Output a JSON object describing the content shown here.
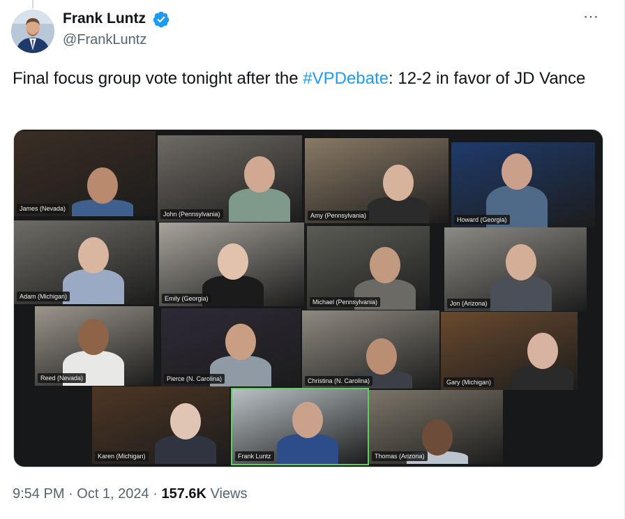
{
  "author": {
    "name": "Frank Luntz",
    "handle": "@FrankLuntz",
    "verified": true
  },
  "more_icon": "⋯",
  "tweet": {
    "text_before": "Final focus group vote tonight after the ",
    "hashtag": "#VPDebate",
    "text_after": ":  12-2 in favor of JD Vance"
  },
  "media": {
    "participants": [
      {
        "label": "James (Nevada)"
      },
      {
        "label": "John (Pennsylvania)"
      },
      {
        "label": "Amy (Pennsylvania)"
      },
      {
        "label": "Howard (Georgia)"
      },
      {
        "label": "Adam (Michigan)"
      },
      {
        "label": "Emily (Georgia)"
      },
      {
        "label": "Michael (Pennsylvania)"
      },
      {
        "label": "Jon (Arizona)"
      },
      {
        "label": "Reed (Nevada)"
      },
      {
        "label": "Pierce (N. Carolina)"
      },
      {
        "label": "Christina (N. Carolina)"
      },
      {
        "label": "Gary (Michigan)"
      },
      {
        "label": "Karen (Michigan)"
      },
      {
        "label": "Frank Luntz"
      },
      {
        "label": "Thomas (Arizona)"
      }
    ]
  },
  "meta": {
    "time": "9:54 PM",
    "separator": " · ",
    "date": "Oct 1, 2024",
    "views_count": "157.6K",
    "views_label": " Views"
  },
  "colors": {
    "hashtag": "#1d9bf0",
    "secondary_text": "#536471",
    "verified_badge": "#1d9bf0"
  }
}
